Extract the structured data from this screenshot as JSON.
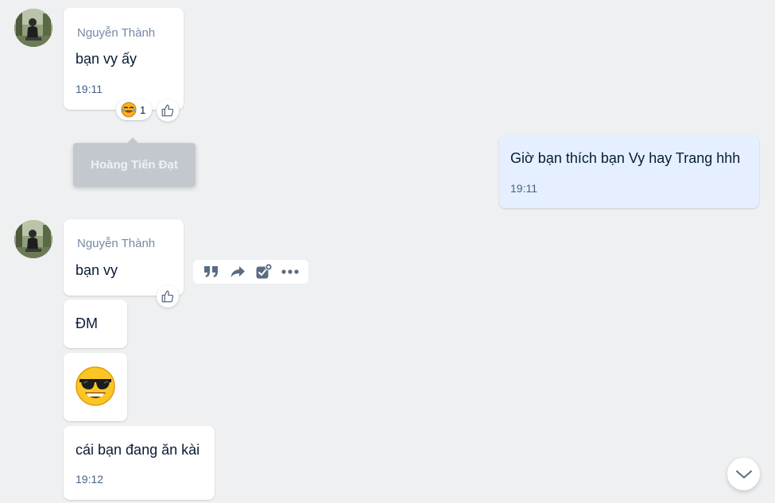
{
  "conversation": {
    "group1": {
      "sender": "Nguyễn Thành",
      "message": "bạn vy ấy",
      "time": "19:11",
      "reaction": {
        "icon": "laughing-crying-emoji-icon",
        "count": "1"
      }
    },
    "tooltip": {
      "text": "Hoàng Tiến Đạt"
    },
    "my_message": {
      "text": "Giờ bạn thích bạn Vy hay Trang hhh",
      "time": "19:11"
    },
    "group2": {
      "sender": "Nguyễn Thành",
      "message1": "bạn vy",
      "message2": "ĐM",
      "sticker": "sunglasses-emoji-icon",
      "message3": "cái bạn đang ăn kài",
      "time": "19:12"
    },
    "action_bar": {
      "icons": [
        "quote-icon",
        "forward-icon",
        "add-task-icon",
        "more-icon"
      ]
    }
  },
  "colors": {
    "background": "#eef0f1",
    "my_bubble": "#e5efff",
    "other_bubble": "#ffffff",
    "sender_name": "#7589a3",
    "time_text": "#476285",
    "message_text": "#081c36",
    "tooltip_bg": "#c3c8cf"
  }
}
